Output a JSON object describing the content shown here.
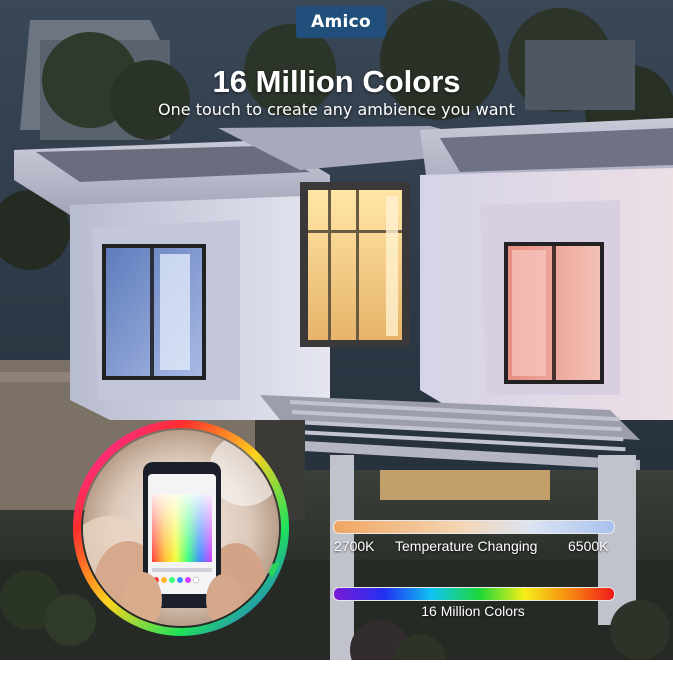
{
  "brand": {
    "logo_text": "Amico",
    "badge_color": "#1f4f7a"
  },
  "headline": "16 Million Colors",
  "subheadline": "One touch to create any ambience you want",
  "temperature_scale": {
    "low_label": "2700K",
    "caption": "Temperature Changing",
    "high_label": "6500K"
  },
  "color_scale": {
    "caption": "16 Million Colors"
  },
  "colors": {
    "sky": "#2b3a4c",
    "wall": "#d9dbe8",
    "window_blue": "#7e98cf",
    "window_warm": "#f5e0a8",
    "window_pink": "#e9a59c"
  },
  "icons": [
    "phone-app-icon",
    "color-wheel-icon"
  ]
}
